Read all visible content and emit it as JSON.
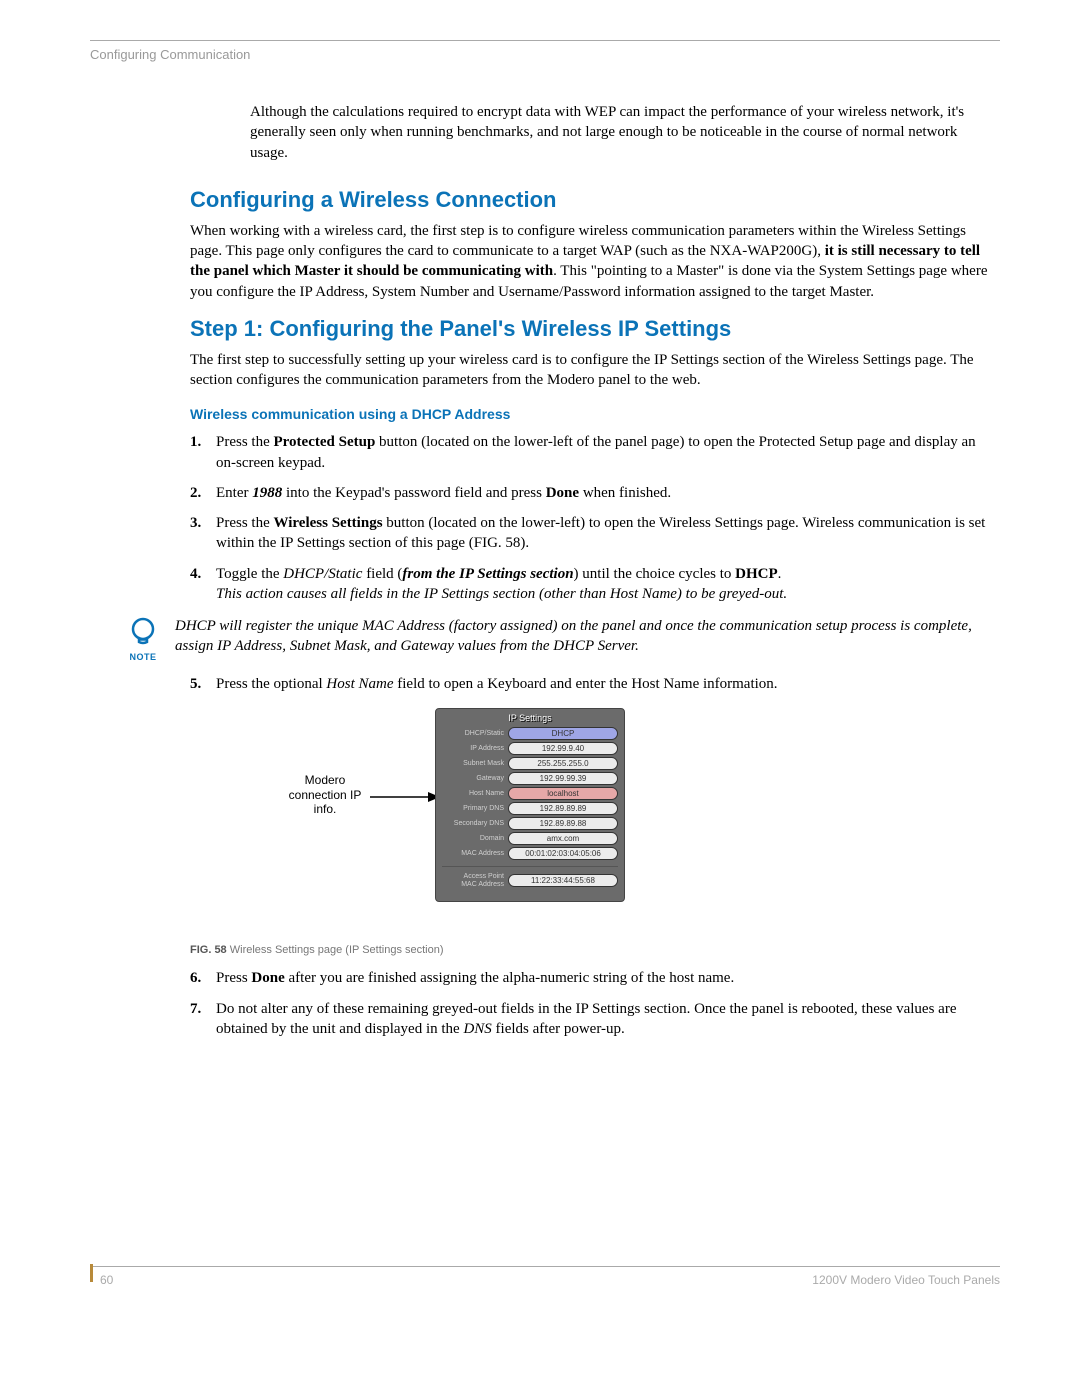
{
  "header": {
    "section": "Configuring Communication"
  },
  "intro": "Although the calculations required to encrypt data with WEP can impact the performance of your wireless network, it's generally seen only when running benchmarks, and not large enough to be noticeable in the course of normal network usage.",
  "h1": "Configuring a Wireless Connection",
  "p1_a": "When working with a wireless card, the first step is to configure wireless communication parameters within the Wireless Settings page. This page only configures the card to communicate to a target WAP (such as the NXA-WAP200G), ",
  "p1_b": "it is still necessary to tell the panel which Master it should be communicating with",
  "p1_c": ". This \"pointing to a Master\" is done via the System Settings page where you configure the IP Address, System Number and Username/Password information assigned to the target Master.",
  "h2": "Step 1: Configuring the Panel's Wireless IP Settings",
  "p2": "The first step to successfully setting up your wireless card is to configure the IP Settings section of the Wireless Settings page. The section configures the communication parameters from the Modero panel to the web.",
  "sub1": "Wireless communication using a DHCP Address",
  "steps": {
    "s1_a": "Press the ",
    "s1_b": "Protected Setup",
    "s1_c": " button (located on the lower-left of the panel page) to open the Protected Setup page and display an on-screen keypad.",
    "s2_a": "Enter ",
    "s2_b": "1988",
    "s2_c": " into the Keypad's password field and press ",
    "s2_d": "Done",
    "s2_e": " when finished.",
    "s3_a": "Press the ",
    "s3_b": "Wireless Settings",
    "s3_c": " button (located on the lower-left) to open the Wireless Settings page. Wireless communication is set within the IP Settings section of this page (FIG. 58).",
    "s4_a": "Toggle the ",
    "s4_b": "DHCP/Static",
    "s4_c": " field (",
    "s4_d": "from the IP Settings section",
    "s4_e": ") until the choice cycles to ",
    "s4_f": "DHCP",
    "s4_g": ".",
    "s4_note": "This action causes all fields in the IP Settings section (other than Host Name) to be greyed-out.",
    "s5_a": "Press the optional ",
    "s5_b": "Host Name",
    "s5_c": " field to open a Keyboard and enter the Host Name information.",
    "s6_a": "Press ",
    "s6_b": "Done",
    "s6_c": " after you are finished assigning the alpha-numeric string of the host name.",
    "s7_a": "Do not alter any of these remaining greyed-out fields in the IP Settings section. Once the panel is rebooted, these values are obtained by the unit and displayed in the ",
    "s7_b": "DNS",
    "s7_c": " fields after power-up."
  },
  "note": {
    "label": "NOTE",
    "text": "DHCP will register the unique MAC Address (factory assigned) on the panel and once the communication setup process is complete, assign IP Address, Subnet Mask, and Gateway values from the DHCP Server."
  },
  "figure": {
    "callout": "Modero connection IP info.",
    "panel_title": "IP Settings",
    "rows": [
      {
        "label": "DHCP/Static",
        "value": "DHCP",
        "cls": "pill-blue"
      },
      {
        "label": "IP Address",
        "value": "192.99.9.40",
        "cls": ""
      },
      {
        "label": "Subnet Mask",
        "value": "255.255.255.0",
        "cls": ""
      },
      {
        "label": "Gateway",
        "value": "192.99.99.39",
        "cls": ""
      },
      {
        "label": "Host Name",
        "value": "localhost",
        "cls": "pill-pink"
      },
      {
        "label": "Primary DNS",
        "value": "192.89.89.89",
        "cls": ""
      },
      {
        "label": "Secondary DNS",
        "value": "192.89.89.88",
        "cls": ""
      },
      {
        "label": "Domain",
        "value": "amx.com",
        "cls": ""
      },
      {
        "label": "MAC Address",
        "value": "00:01:02:03:04:05:06",
        "cls": ""
      }
    ],
    "ap_label": "Access Point\nMAC Address",
    "ap_value": "11:22:33:44:55:68",
    "caption_prefix": "FIG. 58",
    "caption_text": " Wireless Settings page (IP Settings section)"
  },
  "footer": {
    "page": "60",
    "product": "1200V Modero Video Touch Panels"
  }
}
